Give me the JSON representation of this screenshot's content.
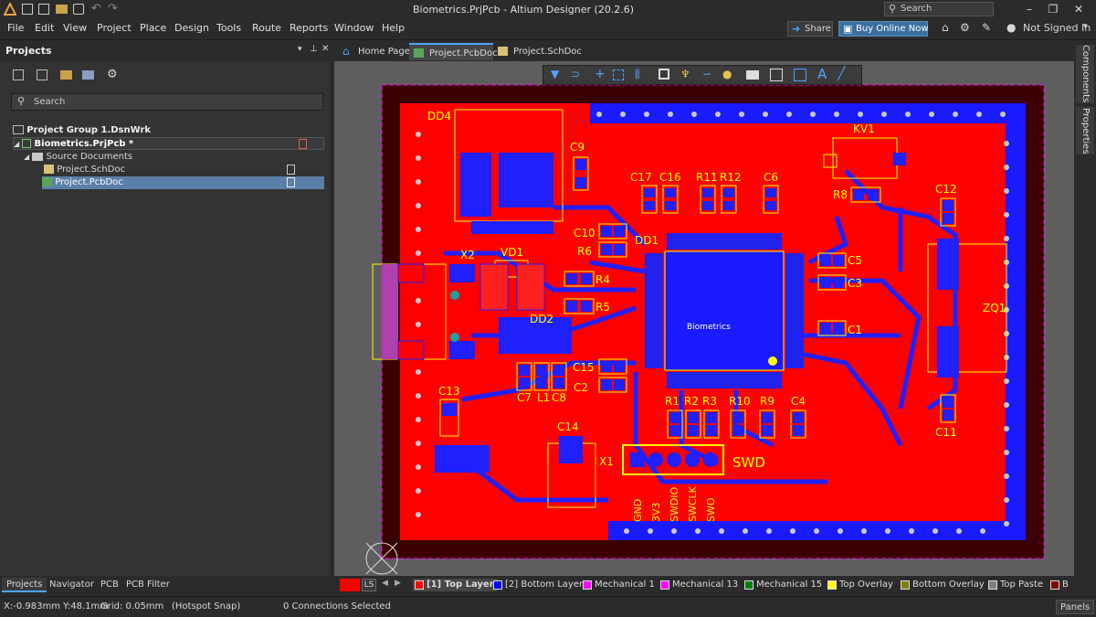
{
  "window": {
    "title": "Biometrics.PrjPcb - Altium Designer (20.2.6)",
    "search_placeholder": "Search"
  },
  "menu": [
    "File",
    "Edit",
    "View",
    "Project",
    "Place",
    "Design",
    "Tools",
    "Route",
    "Reports",
    "Window",
    "Help"
  ],
  "toolbar_right": {
    "share": "Share",
    "buy_online": "Buy Online Now",
    "signed_in": "Not Signed In"
  },
  "projects_panel": {
    "title": "Projects",
    "search_placeholder": "Search",
    "tree": {
      "group": "Project Group 1.DsnWrk",
      "project": "Biometrics.PrjPcb *",
      "folder": "Source Documents",
      "files": [
        "Project.SchDoc",
        "Project.PcbDoc"
      ]
    },
    "bottom_tabs": [
      "Projects",
      "Navigator",
      "PCB",
      "PCB Filter"
    ]
  },
  "doc_tabs": [
    "Home Page",
    "Project.PcbDoc",
    "Project.SchDoc"
  ],
  "pcb": {
    "board_label": "Biometrics",
    "designators": [
      "DD4",
      "C9",
      "C17",
      "C16",
      "R11",
      "R12",
      "C6",
      "KV1",
      "R8",
      "C12",
      "X2",
      "VD1",
      "C10",
      "R6",
      "DD1",
      "C5",
      "C3",
      "R4",
      "R5",
      "ZQ1",
      "DD2",
      "C1",
      "C15",
      "C2",
      "C13",
      "C7",
      "L1",
      "C8",
      "R1",
      "R2",
      "R3",
      "R10",
      "R9",
      "C4",
      "C14",
      "C11",
      "X1",
      "SWD"
    ],
    "swd_pins": [
      "GND",
      "3V3",
      "SWDIO",
      "SWCLK",
      "SWO"
    ]
  },
  "layers": {
    "ls": "LS",
    "items": [
      {
        "label": "[1] Top Layer",
        "color": "#ff0000"
      },
      {
        "label": "[2] Bottom Layer",
        "color": "#0000ff"
      },
      {
        "label": "Mechanical 1",
        "color": "#ff00ff"
      },
      {
        "label": "Mechanical 13",
        "color": "#ff00ff"
      },
      {
        "label": "Mechanical 15",
        "color": "#008000"
      },
      {
        "label": "Top Overlay",
        "color": "#ffff00"
      },
      {
        "label": "Bottom Overlay",
        "color": "#808000"
      },
      {
        "label": "Top Paste",
        "color": "#808080"
      },
      {
        "label": "B",
        "color": "#800000"
      }
    ]
  },
  "right_tabs": [
    "Components",
    "Properties"
  ],
  "status": {
    "coords": "X:-0.983mm Y:48.1mm",
    "grid": "Grid: 0.05mm",
    "snap": "(Hotspot Snap)",
    "selection": "0 Connections Selected",
    "panels": "Panels"
  }
}
